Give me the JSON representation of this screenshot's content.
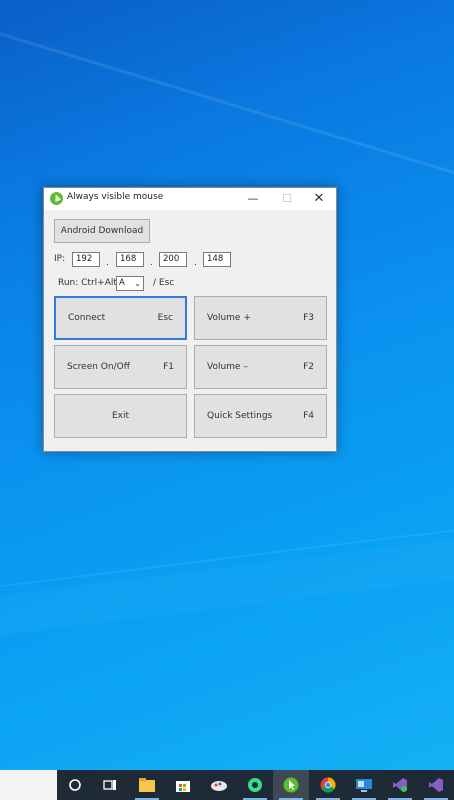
{
  "window": {
    "title": "Always visible mouse",
    "minimize_glyph": "—",
    "maximize_glyph": "☐",
    "close_glyph": "✕"
  },
  "android_download_label": "Android Download",
  "ip": {
    "label": "IP:",
    "octets": [
      "192",
      "168",
      "200",
      "148"
    ],
    "separator": "."
  },
  "run": {
    "label": "Run: Ctrl+Alt+",
    "selected_key": "A",
    "suffix": "/ Esc"
  },
  "buttons": {
    "connect": {
      "label": "Connect",
      "key": "Esc"
    },
    "volume_up": {
      "label": "Volume +",
      "key": "F3"
    },
    "screen": {
      "label": "Screen On/Off",
      "key": "F1"
    },
    "volume_down": {
      "label": "Volume –",
      "key": "F2"
    },
    "exit": {
      "label": "Exit"
    },
    "quick_settings": {
      "label": "Quick Settings",
      "key": "F4"
    }
  },
  "taskbar": {
    "icons": [
      "cortana-icon",
      "task-view-icon",
      "file-explorer-icon",
      "store-icon",
      "paint-icon",
      "android-studio-icon",
      "always-visible-mouse-icon",
      "chrome-icon",
      "remote-desktop-icon",
      "visual-studio-icon",
      "visual-studio-preview-icon"
    ],
    "colors": {
      "taskbar": "#1e2a35",
      "accent": "#2f7bd6"
    }
  }
}
